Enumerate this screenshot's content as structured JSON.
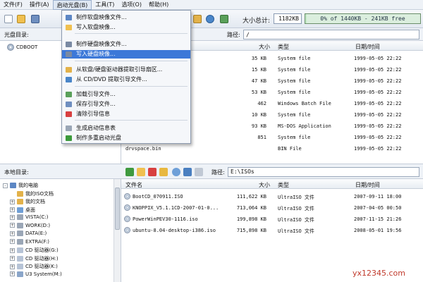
{
  "menubar": {
    "items": [
      "文件(F)",
      "操作(A)",
      "启动光盘(B)",
      "工具(T)",
      "选项(O)",
      "帮助(H)"
    ]
  },
  "toolbar": {
    "size_label": "大小总计:",
    "size_total": "1182KB",
    "capacity_text": "0% of 1440KB - 241KB free",
    "capacity_fraction": 0.01
  },
  "upper": {
    "tree_label": "光盘目录:",
    "path_label": "路径:",
    "path_value": "/",
    "tree_root": "CDBOOT",
    "columns": [
      "大小",
      "类型",
      "日期/时间"
    ],
    "rows": [
      {
        "name": "",
        "size": "35 KB",
        "type": "System file",
        "date": "1999-05-05 22:22"
      },
      {
        "name": "",
        "size": "15 KB",
        "type": "System file",
        "date": "1999-05-05 22:22"
      },
      {
        "name": "",
        "size": "47 KB",
        "type": "System file",
        "date": "1999-05-05 22:22"
      },
      {
        "name": "",
        "size": "53 KB",
        "type": "System file",
        "date": "1999-05-05 22:22"
      },
      {
        "name": "",
        "size": "462",
        "type": "Windows Batch File",
        "date": "1999-05-05 22:22"
      },
      {
        "name": "",
        "size": "10 KB",
        "type": "System file",
        "date": "1999-05-05 22:22"
      },
      {
        "name": "",
        "size": "93 KB",
        "type": "MS-DOS Application",
        "date": "1999-05-05 22:22"
      },
      {
        "name": "",
        "size": "851",
        "type": "System file",
        "date": "1999-05-05 22:22"
      },
      {
        "name": "drvspace.bin",
        "size": "",
        "type": "BIN File",
        "date": "1999-05-05 22:22"
      }
    ]
  },
  "lower": {
    "tree_label": "本地目录:",
    "path_label": "路径:",
    "path_value": "E:\\ISOs",
    "tree": [
      {
        "label": "我的电脑",
        "depth": 0,
        "expander": "-"
      },
      {
        "label": "我的ISO文档",
        "depth": 1,
        "expander": ""
      },
      {
        "label": "我的文档",
        "depth": 1,
        "expander": "+"
      },
      {
        "label": "桌面",
        "depth": 1,
        "expander": "+"
      },
      {
        "label": "VISTA(C:)",
        "depth": 1,
        "expander": "+"
      },
      {
        "label": "WORK(D:)",
        "depth": 1,
        "expander": "+"
      },
      {
        "label": "DATA(E:)",
        "depth": 1,
        "expander": "+"
      },
      {
        "label": "EXTRA(F:)",
        "depth": 1,
        "expander": "+"
      },
      {
        "label": "CD 驱动器(G:)",
        "depth": 1,
        "expander": "+"
      },
      {
        "label": "CD 驱动器(H:)",
        "depth": 1,
        "expander": "+"
      },
      {
        "label": "CD 驱动器(K:)",
        "depth": 1,
        "expander": "+"
      },
      {
        "label": "U3 System(M:)",
        "depth": 1,
        "expander": "+"
      }
    ],
    "columns": [
      "文件名",
      "大小",
      "类型",
      "日期/时间"
    ],
    "rows": [
      {
        "name": "BootCD_070911.ISO",
        "size": "111,622 KB",
        "type": "UltraISO 文件",
        "date": "2007-09-11 18:00"
      },
      {
        "name": "KNOPPIX_V5.1.1CD-2007-01-0...",
        "size": "713,064 KB",
        "type": "UltraISO 文件",
        "date": "2007-04-05 00:50"
      },
      {
        "name": "PowerWinPEV30-1116.iso",
        "size": "199,898 KB",
        "type": "UltraISO 文件",
        "date": "2007-11-15 21:26"
      },
      {
        "name": "ubuntu-8.04-desktop-i386.iso",
        "size": "715,898 KB",
        "type": "UltraISO 文件",
        "date": "2008-05-01 19:56"
      }
    ]
  },
  "dropdown": {
    "items": [
      "制作软盘映像文件...",
      "写入软盘映像...",
      "制作硬盘映像文件...",
      "写入硬盘映像...",
      "从软盘/硬盘驱动器提取引导扇区...",
      "从 CD/DVD 提取引导文件...",
      "加载引导文件...",
      "保存引导文件...",
      "清除引导信息",
      "生成启动信息表",
      "制作多重启动光盘"
    ],
    "highlighted_index": 3
  },
  "watermark": "yx12345.com"
}
